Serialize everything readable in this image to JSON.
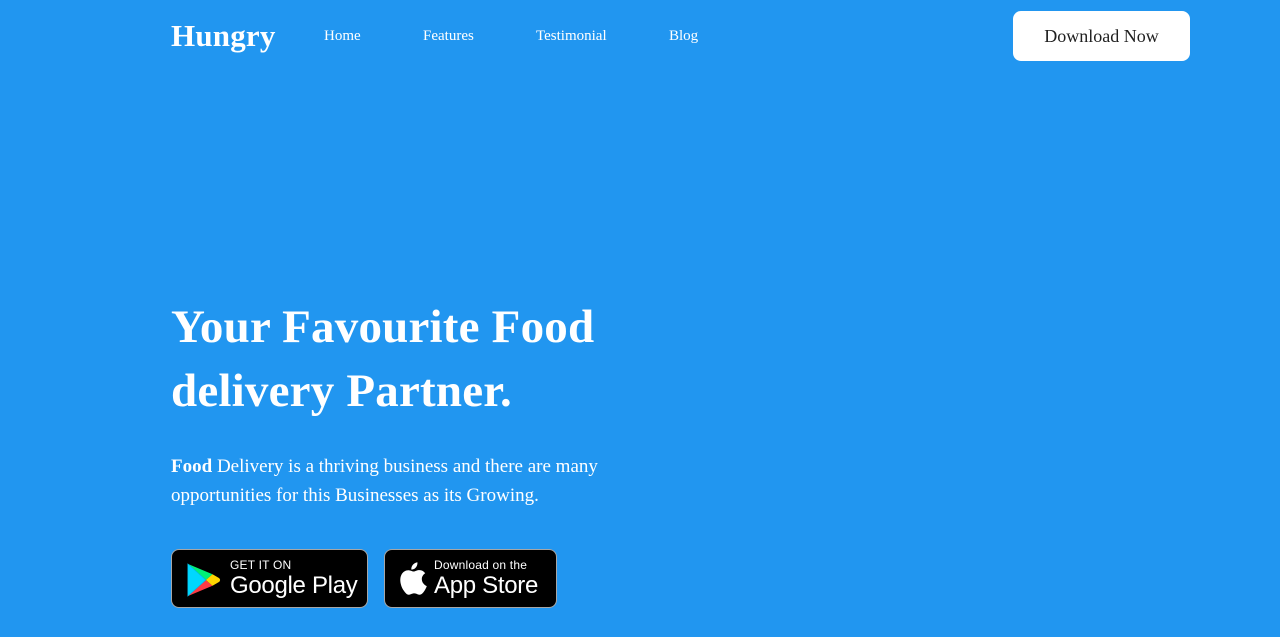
{
  "header": {
    "brand": "Hungry",
    "nav": {
      "home": "Home",
      "features": "Features",
      "testimonial": "Testimonial",
      "blog": "Blog"
    },
    "cta_label": "Download Now"
  },
  "hero": {
    "title": "Your Favourite Food delivery Partner.",
    "description_bold": "Food",
    "description_rest": " Delivery is a thriving business and there are many opportunities for this Businesses as its Growing."
  },
  "stores": {
    "google_play": {
      "small_text": "GET IT ON",
      "large_text": "Google Play",
      "icon": "google-play-icon"
    },
    "app_store": {
      "small_text": "Download on the",
      "large_text": "App Store",
      "icon": "apple-icon"
    }
  },
  "colors": {
    "background": "#2196f0",
    "text": "#ffffff",
    "button_background": "#ffffff",
    "button_text": "#1f1f1f",
    "badge_background": "#000000"
  }
}
